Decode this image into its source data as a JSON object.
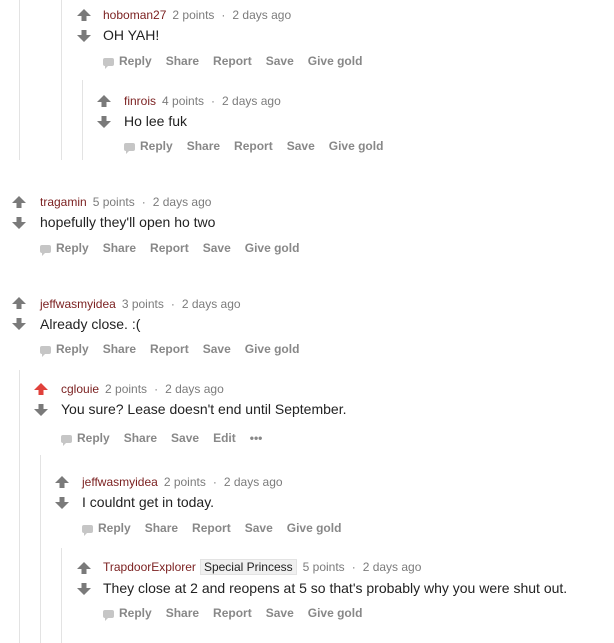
{
  "actions": {
    "reply": "Reply",
    "share": "Share",
    "report": "Report",
    "save": "Save",
    "give_gold": "Give gold",
    "edit": "Edit",
    "more": "•••"
  },
  "colors": {
    "upvote_active": "#e0413b",
    "vote_default": "#7a7a7a",
    "author": "#7a1f1f",
    "rail": "#e3e3e3"
  },
  "comments": [
    {
      "author": "hoboman27",
      "points": "2 points",
      "sep": "·",
      "time": "2 days ago",
      "text": "OH YAH!"
    },
    {
      "author": "finrois",
      "points": "4 points",
      "sep": "·",
      "time": "2 days ago",
      "text": "Ho lee fuk"
    },
    {
      "author": "tragamin",
      "points": "5 points",
      "sep": "·",
      "time": "2 days ago",
      "text": "hopefully they'll open ho two"
    },
    {
      "author": "jeffwasmyidea",
      "points": "3 points",
      "sep": "·",
      "time": "2 days ago",
      "text": "Already close. :("
    },
    {
      "author": "cglouie",
      "points": "2 points",
      "sep": "·",
      "time": "2 days ago",
      "text": "You sure? Lease doesn't end until September.",
      "upvoted": true
    },
    {
      "author": "jeffwasmyidea",
      "points": "2 points",
      "sep": "·",
      "time": "2 days ago",
      "text": "I couldnt get in today."
    },
    {
      "author": "TrapdoorExplorer",
      "flair": "Special Princess",
      "points": "5 points",
      "sep": "·",
      "time": "2 days ago",
      "text": "They close at 2 and reopens at 5 so that's probably why you were shut out."
    }
  ]
}
